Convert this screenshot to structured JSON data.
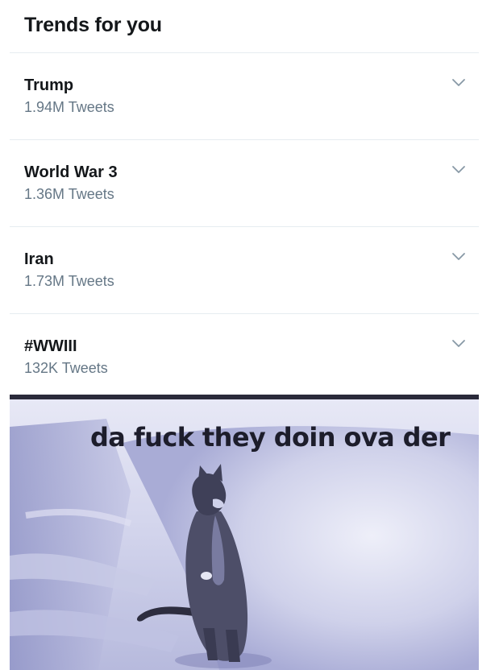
{
  "trends_panel": {
    "title": "Trends for you",
    "items": [
      {
        "name": "Trump",
        "count": "1.94M Tweets"
      },
      {
        "name": "World War 3",
        "count": "1.36M Tweets"
      },
      {
        "name": "Iran",
        "count": "1.73M Tweets"
      },
      {
        "name": "#WWIII",
        "count": "132K Tweets"
      }
    ],
    "more_icon": "chevron-down-icon"
  },
  "meme": {
    "caption": "da fuck they doin ova der"
  },
  "colors": {
    "text_primary": "#14171a",
    "text_secondary": "#657786",
    "divider": "#e6ecf0",
    "chevron": "#8899a6"
  }
}
